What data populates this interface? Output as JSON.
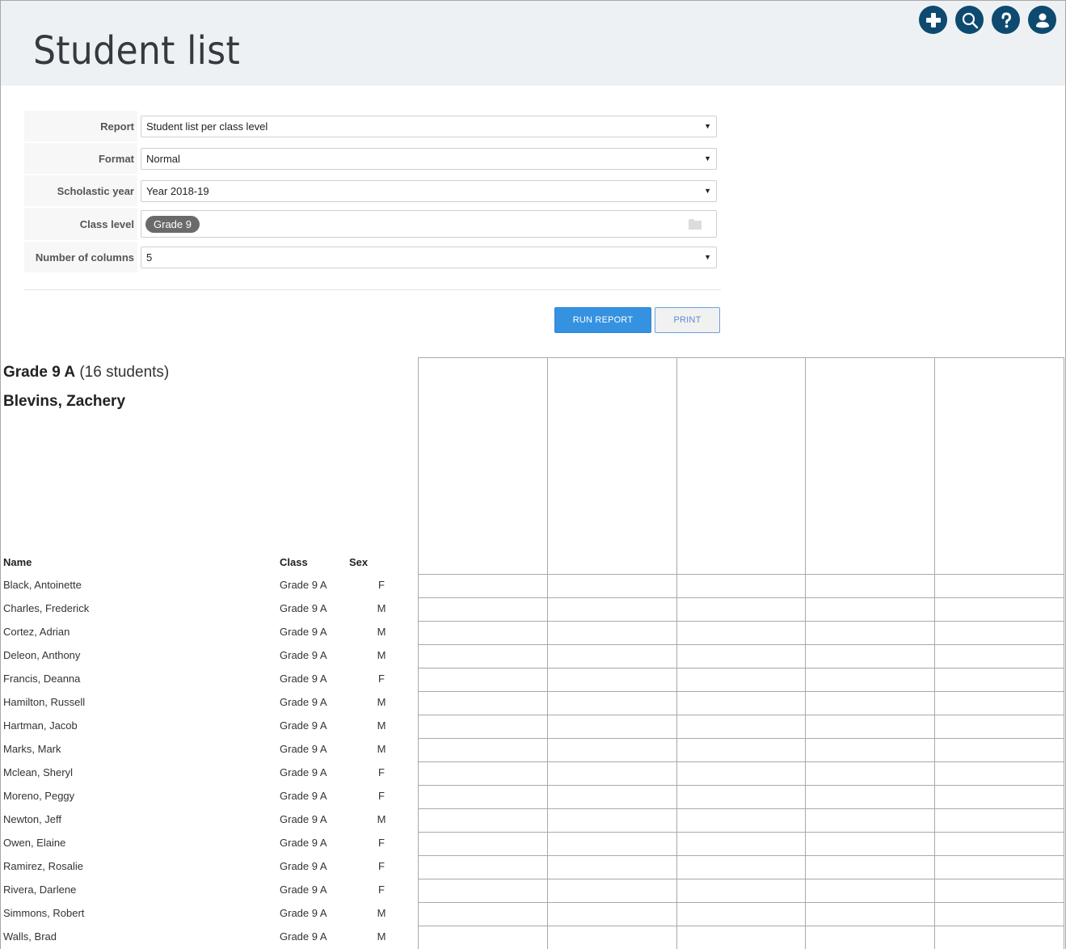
{
  "header": {
    "title": "Student list",
    "icons": [
      {
        "name": "add-icon",
        "label": "Add"
      },
      {
        "name": "search-icon",
        "label": "Search"
      },
      {
        "name": "help-icon",
        "label": "Help"
      },
      {
        "name": "user-icon",
        "label": "Account"
      }
    ],
    "icon_color": "#0e4a70"
  },
  "form": {
    "report": {
      "label": "Report",
      "value": "Student list per class level"
    },
    "format": {
      "label": "Format",
      "value": "Normal"
    },
    "year": {
      "label": "Scholastic year",
      "value": "Year 2018-19"
    },
    "class_level": {
      "label": "Class level",
      "tags": [
        "Grade 9"
      ]
    },
    "columns": {
      "label": "Number of columns",
      "value": "5"
    }
  },
  "actions": {
    "run_label": "RUN REPORT",
    "print_label": "PRINT",
    "accent": "#3592e0"
  },
  "report": {
    "group_name": "Grade 9 A",
    "group_count": "(16 students)",
    "teacher": "Blevins, Zachery",
    "columns": {
      "name": "Name",
      "class": "Class",
      "sex": "Sex"
    },
    "extra_columns": 5,
    "students": [
      {
        "name": "Black, Antoinette",
        "class": "Grade 9 A",
        "sex": "F"
      },
      {
        "name": "Charles, Frederick",
        "class": "Grade 9 A",
        "sex": "M"
      },
      {
        "name": "Cortez, Adrian",
        "class": "Grade 9 A",
        "sex": "M"
      },
      {
        "name": "Deleon, Anthony",
        "class": "Grade 9 A",
        "sex": "M"
      },
      {
        "name": "Francis, Deanna",
        "class": "Grade 9 A",
        "sex": "F"
      },
      {
        "name": "Hamilton, Russell",
        "class": "Grade 9 A",
        "sex": "M"
      },
      {
        "name": "Hartman, Jacob",
        "class": "Grade 9 A",
        "sex": "M"
      },
      {
        "name": "Marks, Mark",
        "class": "Grade 9 A",
        "sex": "M"
      },
      {
        "name": "Mclean, Sheryl",
        "class": "Grade 9 A",
        "sex": "F"
      },
      {
        "name": "Moreno, Peggy",
        "class": "Grade 9 A",
        "sex": "F"
      },
      {
        "name": "Newton, Jeff",
        "class": "Grade 9 A",
        "sex": "M"
      },
      {
        "name": "Owen, Elaine",
        "class": "Grade 9 A",
        "sex": "F"
      },
      {
        "name": "Ramirez, Rosalie",
        "class": "Grade 9 A",
        "sex": "F"
      },
      {
        "name": "Rivera, Darlene",
        "class": "Grade 9 A",
        "sex": "F"
      },
      {
        "name": "Simmons, Robert",
        "class": "Grade 9 A",
        "sex": "M"
      },
      {
        "name": "Walls, Brad",
        "class": "Grade 9 A",
        "sex": "M"
      }
    ]
  }
}
